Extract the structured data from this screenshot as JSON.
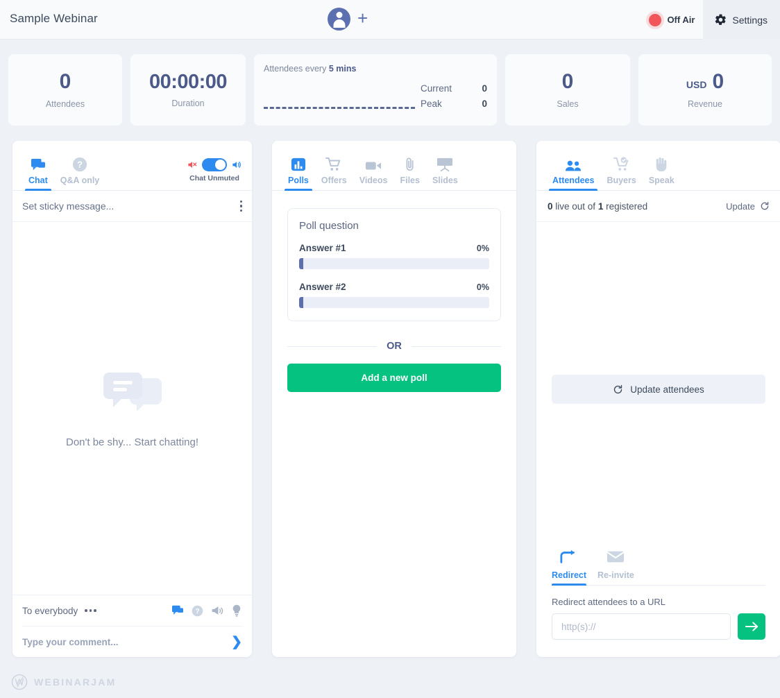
{
  "header": {
    "webinar_title": "Sample Webinar",
    "avatar_icon": "user-avatar-icon",
    "add_presenter_icon": "plus-icon",
    "broadcast_status": "Off Air",
    "broadcast_status_color": "#f2555a",
    "settings_label": "Settings",
    "settings_icon": "gear-icon"
  },
  "stats": {
    "attendees": {
      "value": "0",
      "label": "Attendees"
    },
    "duration": {
      "value": "00:00:00",
      "label": "Duration"
    },
    "chart": {
      "title_prefix": "Attendees every ",
      "title_strong": "5 mins",
      "current_label": "Current",
      "current_value": "0",
      "peak_label": "Peak",
      "peak_value": "0"
    },
    "sales": {
      "value": "0",
      "label": "Sales"
    },
    "revenue": {
      "currency": "USD",
      "value": "0",
      "label": "Revenue"
    }
  },
  "chat_panel": {
    "tabs": [
      {
        "label": "Chat",
        "icon": "chat-bubble-icon",
        "active": true
      },
      {
        "label": "Q&A only",
        "icon": "question-circle-icon",
        "active": false
      }
    ],
    "mute_caption": "Chat Unmuted",
    "mute_icon": "speaker-muted-icon",
    "unmute_icon": "speaker-on-icon",
    "toggle_state": "on",
    "sticky_message": "Set sticky message...",
    "kebab_icon": "kebab-menu-icon",
    "empty_icon": "chat-bubbles-icon",
    "empty_caption": "Don't be shy... Start chatting!",
    "recipient": "To everybody",
    "recipient_dots_icon": "ellipsis-icon",
    "footer_icons": [
      "chat-bubble-icon",
      "question-circle-icon",
      "megaphone-icon",
      "lightbulb-icon"
    ],
    "comment_placeholder": "Type your comment...",
    "send_icon": "send-arrow-icon"
  },
  "mid_panel": {
    "tabs": [
      {
        "label": "Polls",
        "icon": "bar-chart-icon",
        "active": true
      },
      {
        "label": "Offers",
        "icon": "shopping-cart-icon",
        "active": false
      },
      {
        "label": "Videos",
        "icon": "video-camera-icon",
        "active": false
      },
      {
        "label": "Files",
        "icon": "paperclip-icon",
        "active": false
      },
      {
        "label": "Slides",
        "icon": "presentation-board-icon",
        "active": false
      }
    ],
    "poll": {
      "question": "Poll question",
      "answers": [
        {
          "label": "Answer #1",
          "percent": "0%",
          "fill": 0
        },
        {
          "label": "Answer #2",
          "percent": "0%",
          "fill": 0
        }
      ]
    },
    "or_divider": "OR",
    "add_poll_label": "Add a new poll",
    "add_poll_color": "#06c281"
  },
  "right_panel": {
    "tabs": [
      {
        "label": "Attendees",
        "icon": "people-icon",
        "active": true
      },
      {
        "label": "Buyers",
        "icon": "cart-check-icon",
        "active": false
      },
      {
        "label": "Speak",
        "icon": "raised-hand-icon",
        "active": false
      }
    ],
    "live_count": "0",
    "live_mid_text": " live out of ",
    "registered_count": "1",
    "live_suffix": " registered",
    "update_label": "Update",
    "update_icon": "refresh-icon",
    "update_attendees_label": "Update attendees",
    "update_attendees_icon": "refresh-icon",
    "redirect_tabs": [
      {
        "label": "Redirect",
        "icon": "arrow-redirect-icon",
        "active": true
      },
      {
        "label": "Re-invite",
        "icon": "envelope-icon",
        "active": false
      }
    ],
    "redirect_label": "Redirect attendees to a URL",
    "redirect_placeholder": "http(s)://",
    "redirect_value": "",
    "redirect_go_icon": "arrow-right-icon",
    "redirect_go_color": "#06c281"
  },
  "footer": {
    "logo_mark": "webinarjam-w-logo",
    "logo_text": "WEBINARJAM"
  }
}
